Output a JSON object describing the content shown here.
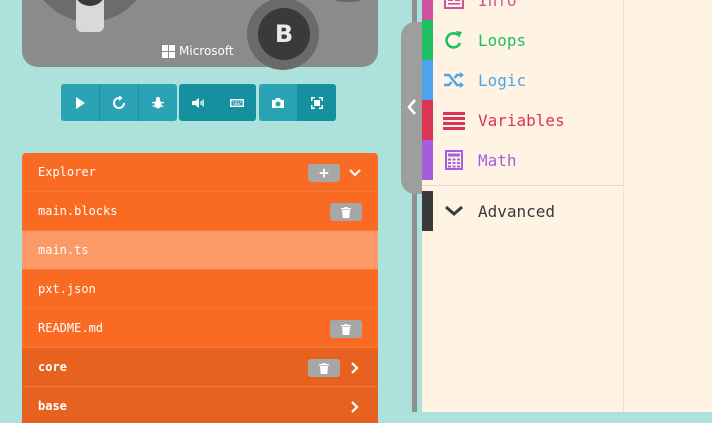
{
  "simulator": {
    "button_b_label": "B",
    "brand_text": "Microsoft"
  },
  "toolbar": {
    "buttons": [
      {
        "name": "play-icon"
      },
      {
        "name": "restart-icon"
      },
      {
        "name": "bug-icon"
      },
      {
        "name": "volume-icon"
      },
      {
        "name": "keyboard-icon"
      },
      {
        "name": "camera-icon"
      },
      {
        "name": "fullscreen-icon"
      }
    ],
    "color": "#2aa4b4"
  },
  "explorer": {
    "title": "Explorer",
    "add_label": "+",
    "files": [
      {
        "label": "main.blocks",
        "deletable": true
      },
      {
        "label": "main.ts",
        "selected": true
      },
      {
        "label": "pxt.json"
      },
      {
        "label": "README.md",
        "deletable": true
      }
    ],
    "packages": [
      {
        "label": "core",
        "deletable": true
      },
      {
        "label": "base"
      }
    ],
    "color": "#f96b23"
  },
  "toolbox": {
    "categories": [
      {
        "label": "Info",
        "color": "#d0539d",
        "icon": "info-icon"
      },
      {
        "label": "Loops",
        "color": "#21bf61",
        "icon": "loop-icon"
      },
      {
        "label": "Logic",
        "color": "#4ea4ee",
        "icon": "shuffle-icon"
      },
      {
        "label": "Variables",
        "color": "#dc3455",
        "icon": "list-icon"
      },
      {
        "label": "Math",
        "color": "#a55ed9",
        "icon": "calculator-icon"
      }
    ],
    "advanced": {
      "label": "Advanced",
      "color": "#3a3a3a",
      "icon": "chevron-down-icon"
    }
  }
}
